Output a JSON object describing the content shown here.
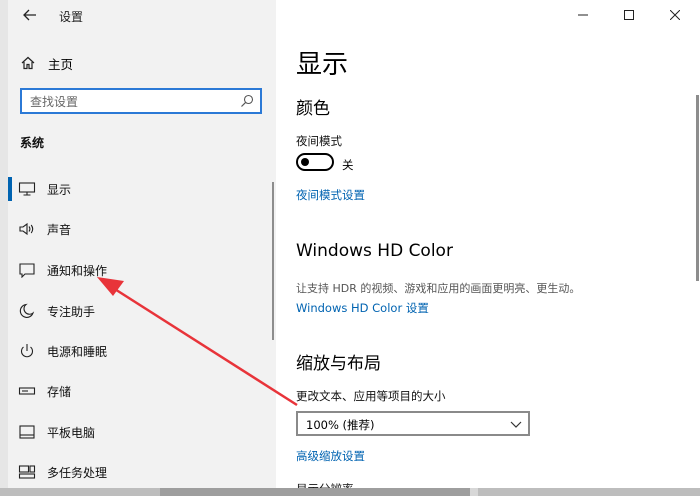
{
  "window": {
    "title": "设置"
  },
  "sidebar": {
    "home_label": "主页",
    "search_placeholder": "查找设置",
    "section_label": "系统",
    "items": [
      {
        "label": "显示",
        "icon": "monitor-icon",
        "active": true
      },
      {
        "label": "声音",
        "icon": "speaker-icon"
      },
      {
        "label": "通知和操作",
        "icon": "notification-icon"
      },
      {
        "label": "专注助手",
        "icon": "moon-icon"
      },
      {
        "label": "电源和睡眠",
        "icon": "power-icon"
      },
      {
        "label": "存储",
        "icon": "storage-icon"
      },
      {
        "label": "平板电脑",
        "icon": "tablet-icon"
      },
      {
        "label": "多任务处理",
        "icon": "multitask-icon"
      }
    ]
  },
  "content": {
    "page_title": "显示",
    "color": {
      "heading": "颜色",
      "night_mode_label": "夜间模式",
      "night_mode_state": "关",
      "night_mode_on": false,
      "night_mode_settings_link": "夜间模式设置"
    },
    "hdr": {
      "heading": "Windows HD Color",
      "description": "让支持 HDR 的视频、游戏和应用的画面更明亮、更生动。",
      "settings_link": "Windows HD Color 设置"
    },
    "scale": {
      "heading": "缩放与布局",
      "size_label": "更改文本、应用等项目的大小",
      "size_value": "100% (推荐)",
      "advanced_link": "高级缩放设置",
      "resolution_label": "显示分辨率"
    }
  },
  "colors": {
    "accent": "#0063b1",
    "search_border": "#2b79d6",
    "annotation_arrow": "#e8343a"
  }
}
